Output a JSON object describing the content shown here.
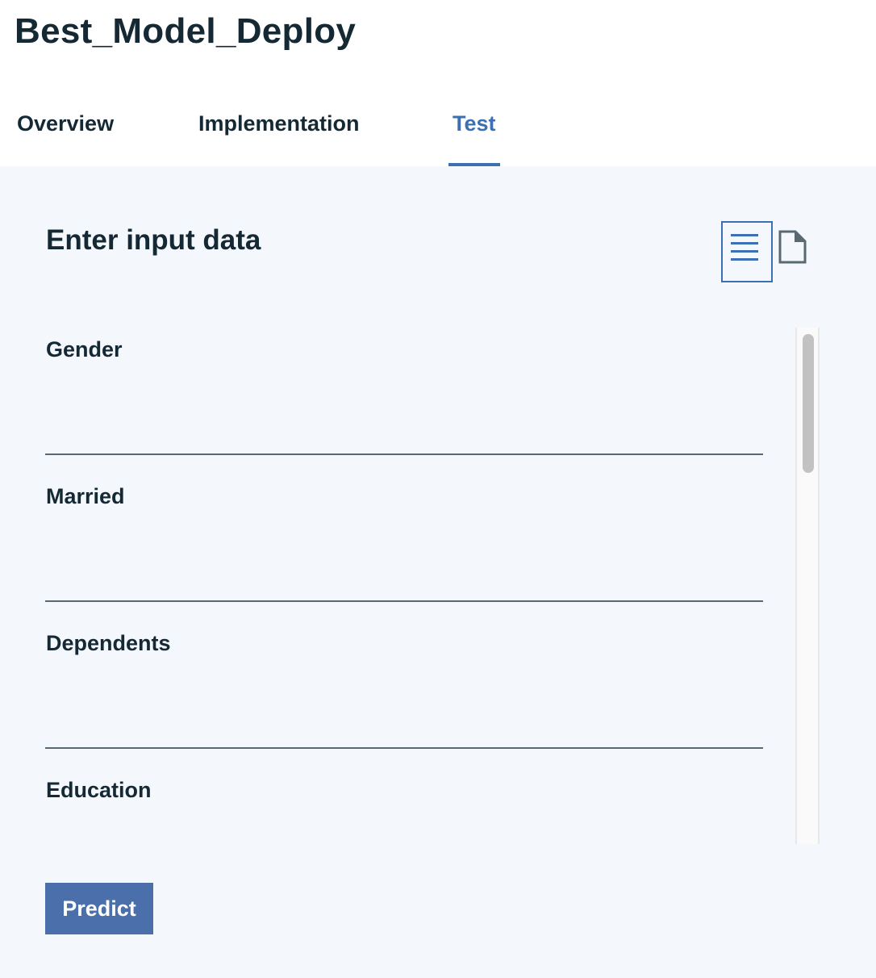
{
  "page": {
    "title": "Best_Model_Deploy"
  },
  "tabs": [
    {
      "label": "Overview",
      "active": false
    },
    {
      "label": "Implementation",
      "active": false
    },
    {
      "label": "Test",
      "active": true
    }
  ],
  "test_panel": {
    "heading": "Enter input data",
    "view_toggle": {
      "form_icon": "list-icon",
      "json_icon": "document-icon",
      "selected": "form"
    },
    "fields": [
      {
        "label": "Gender",
        "value": "",
        "type": "text"
      },
      {
        "label": "Married",
        "value": "",
        "type": "text"
      },
      {
        "label": "Dependents",
        "value": "",
        "type": "text"
      },
      {
        "label": "Education",
        "value": "",
        "type": "select",
        "icon": "chevron-down-icon"
      }
    ],
    "predict_label": "Predict"
  },
  "colors": {
    "accent": "#3d70b2",
    "button": "#4a6faa",
    "text": "#152935",
    "panel_bg": "#f4f7fb"
  }
}
